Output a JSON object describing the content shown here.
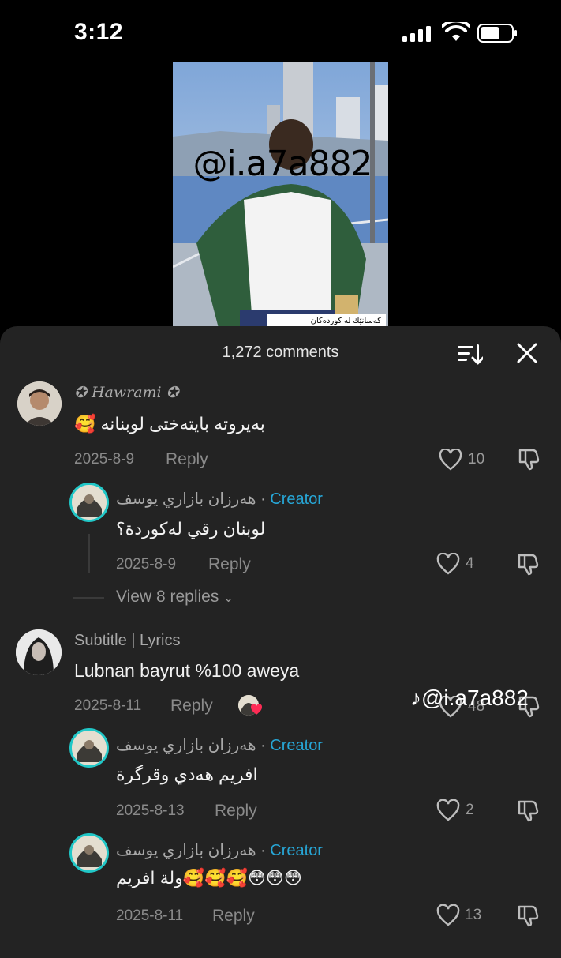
{
  "status": {
    "time": "3:12"
  },
  "video": {
    "watermark": "@i.a7a882",
    "caption": "كەسانێك لە كوردەكان"
  },
  "sheet": {
    "title": "1,272 comments",
    "sort_icon": "sort-icon",
    "close_icon": "close-icon"
  },
  "comments": [
    {
      "user": "✪ Hawrami ✪",
      "text": "🥰 بەیروتە بایتەختی لوبنانە",
      "date": "2025-8-9",
      "reply_label": "Reply",
      "likes": "10",
      "replies": [
        {
          "user": "هەرزان بازاري يوسف",
          "badge": "Creator",
          "text": "لوبنان رقي لەكوردة؟",
          "date": "2025-8-9",
          "reply_label": "Reply",
          "likes": "4"
        }
      ],
      "view_replies": "View 8 replies"
    },
    {
      "user": "Subtitle | Lyrics",
      "text": "Lubnan bayrut %100 aweya",
      "date": "2025-8-11",
      "reply_label": "Reply",
      "likes": "48",
      "replies": [
        {
          "user": "هەرزان بازاري يوسف",
          "badge": "Creator",
          "text": "افريم هەدي وقرگرة",
          "date": "2025-8-13",
          "reply_label": "Reply",
          "likes": "2"
        },
        {
          "user": "هەرزان بازاري يوسف",
          "badge": "Creator",
          "text": "ولة افريم🥰🥰🥰😳😳😳",
          "date": "2025-8-11",
          "reply_label": "Reply",
          "likes": "13"
        }
      ]
    }
  ],
  "overlay_watermark": "@i.a7a882",
  "colors": {
    "sheet_bg": "#232323",
    "creator_accent": "#27a6d6",
    "creator_ring": "#21c7c7"
  }
}
